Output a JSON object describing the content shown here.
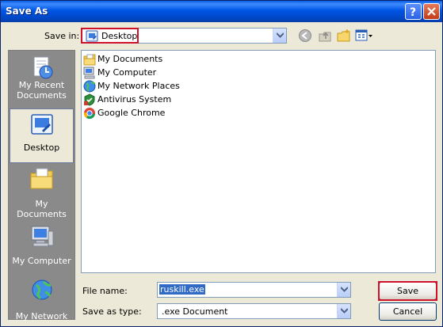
{
  "window": {
    "title": "Save As"
  },
  "save_in": {
    "label": "Save in:",
    "value": "Desktop"
  },
  "places": [
    {
      "label": "My Recent Documents"
    },
    {
      "label": "Desktop"
    },
    {
      "label": "My Documents"
    },
    {
      "label": "My Computer"
    },
    {
      "label": "My Network"
    }
  ],
  "files": [
    {
      "name": "My Documents",
      "icon": "folder-documents-icon"
    },
    {
      "name": "My Computer",
      "icon": "computer-icon"
    },
    {
      "name": "My Network Places",
      "icon": "network-places-icon"
    },
    {
      "name": "Antivirus System",
      "icon": "antivirus-icon"
    },
    {
      "name": "Google Chrome",
      "icon": "chrome-icon"
    }
  ],
  "file_name": {
    "label": "File name:",
    "value": "ruskill.exe"
  },
  "save_as_type": {
    "label": "Save as type:",
    "value": ".exe Document"
  },
  "buttons": {
    "save": "Save",
    "cancel": "Cancel"
  },
  "colors": {
    "title_bar": "#0055e5",
    "highlight": "#d0112b",
    "selection": "#316ac5"
  }
}
